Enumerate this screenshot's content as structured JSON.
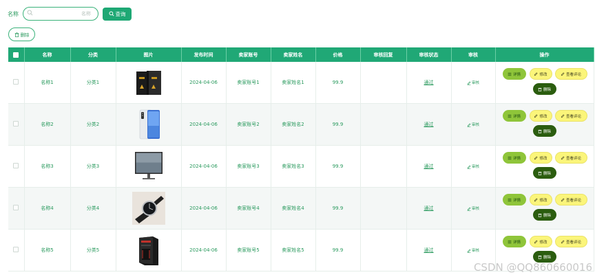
{
  "search": {
    "label": "名称",
    "placeholder": "名称",
    "query_button": "查询"
  },
  "toolbar": {
    "delete_label": "删除"
  },
  "table": {
    "headers": [
      "名称",
      "分类",
      "图片",
      "发布时间",
      "卖家账号",
      "卖家姓名",
      "价格",
      "审核回复",
      "审核状态",
      "审核",
      "操作"
    ],
    "rows": [
      {
        "name": "名称1",
        "category": "分类1",
        "image": "black-phone-box",
        "date": "2024-04-06",
        "account": "卖家账号1",
        "seller": "卖家姓名1",
        "price": "99.9",
        "reply": "",
        "status": "通过",
        "review": "审核"
      },
      {
        "name": "名称2",
        "category": "分类2",
        "image": "smartphone",
        "date": "2024-04-06",
        "account": "卖家账号2",
        "seller": "卖家姓名2",
        "price": "99.9",
        "reply": "",
        "status": "通过",
        "review": "审核"
      },
      {
        "name": "名称3",
        "category": "分类3",
        "image": "monitor",
        "date": "2024-04-06",
        "account": "卖家账号3",
        "seller": "卖家姓名3",
        "price": "99.9",
        "reply": "",
        "status": "通过",
        "review": "审核"
      },
      {
        "name": "名称4",
        "category": "分类4",
        "image": "wristwatch",
        "date": "2024-04-06",
        "account": "卖家账号4",
        "seller": "卖家姓名4",
        "price": "99.9",
        "reply": "",
        "status": "通过",
        "review": "审核"
      },
      {
        "name": "名称5",
        "category": "分类5",
        "image": "pc-case",
        "date": "2024-04-06",
        "account": "卖家账号5",
        "seller": "卖家姓名5",
        "price": "99.9",
        "reply": "",
        "status": "通过",
        "review": "审核"
      }
    ],
    "actions": {
      "detail": "详情",
      "edit": "修改",
      "view_reviews": "查看评论",
      "delete": "删除"
    }
  },
  "watermark": "CSDN @QQ860660016",
  "colors": {
    "header_bg": "#20a876",
    "accent": "#2a9a5e",
    "detail_btn": "#8fc53a",
    "edit_btn": "#fbf57a",
    "delete_btn": "#2b5d0f"
  }
}
